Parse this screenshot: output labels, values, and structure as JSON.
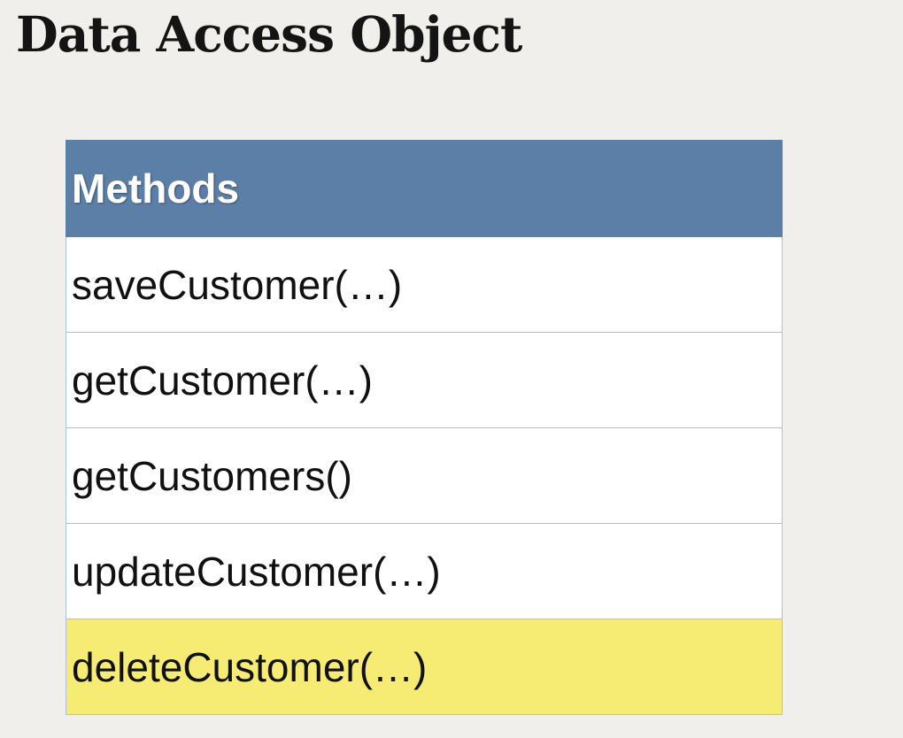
{
  "slide": {
    "title": "Data Access Object"
  },
  "table": {
    "header": "Methods",
    "rows": [
      "saveCustomer(…)",
      "getCustomer(…)",
      "getCustomers()",
      "updateCustomer(…)",
      "deleteCustomer(…)"
    ],
    "highlighted_row": "deleteCustomer(…)"
  },
  "colors": {
    "background": "#f1efeb",
    "header_fill": "#5c7fa8",
    "row_fill": "#ffffff",
    "highlight_fill": "#f6ec73",
    "border": "#aebfd4"
  }
}
